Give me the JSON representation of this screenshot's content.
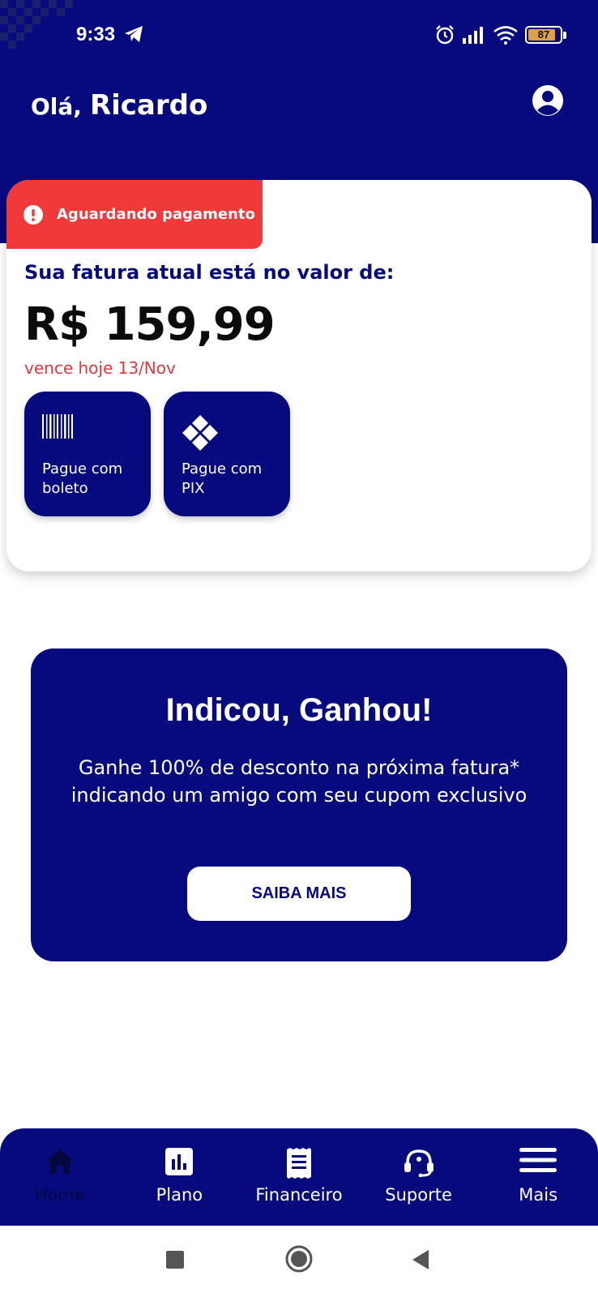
{
  "status_bar": {
    "time": "9:33",
    "battery_level": "87",
    "icons": [
      "telegram-icon",
      "alarm-icon",
      "signal-icon",
      "wifi-icon",
      "battery-icon"
    ]
  },
  "header": {
    "greeting": "Olá,",
    "user_name": "Ricardo",
    "profile_icon": "account-circle-icon"
  },
  "invoice": {
    "status_label": "Aguardando pagamento",
    "status_icon": "alert-circle-icon",
    "heading": "Sua fatura atual está no valor de:",
    "amount": "R$ 159,99",
    "due_text": "vence hoje 13/Nov",
    "actions": [
      {
        "label": "Pague com boleto",
        "icon": "barcode-icon"
      },
      {
        "label": "Pague com PIX",
        "icon": "pix-icon"
      }
    ]
  },
  "promo": {
    "title": "Indicou, Ganhou!",
    "text": "Ganhe 100% de desconto na próxima fatura* indicando um amigo com seu cupom exclusivo",
    "button_label": "SAIBA MAIS"
  },
  "bottom_nav": {
    "items": [
      {
        "label": "Home",
        "icon": "home-icon",
        "active": true
      },
      {
        "label": "Plano",
        "icon": "bar-chart-icon",
        "active": false
      },
      {
        "label": "Financeiro",
        "icon": "receipt-icon",
        "active": false
      },
      {
        "label": "Suporte",
        "icon": "headset-icon",
        "active": false
      },
      {
        "label": "Mais",
        "icon": "menu-icon",
        "active": false
      }
    ]
  },
  "system_nav": {
    "buttons": [
      "recents-square-icon",
      "home-circle-icon",
      "back-triangle-icon"
    ]
  },
  "colors": {
    "primary": "#060a7d",
    "alert": "#f03a3a",
    "due_text": "#e23a3a",
    "battery": "#e0a04a"
  }
}
